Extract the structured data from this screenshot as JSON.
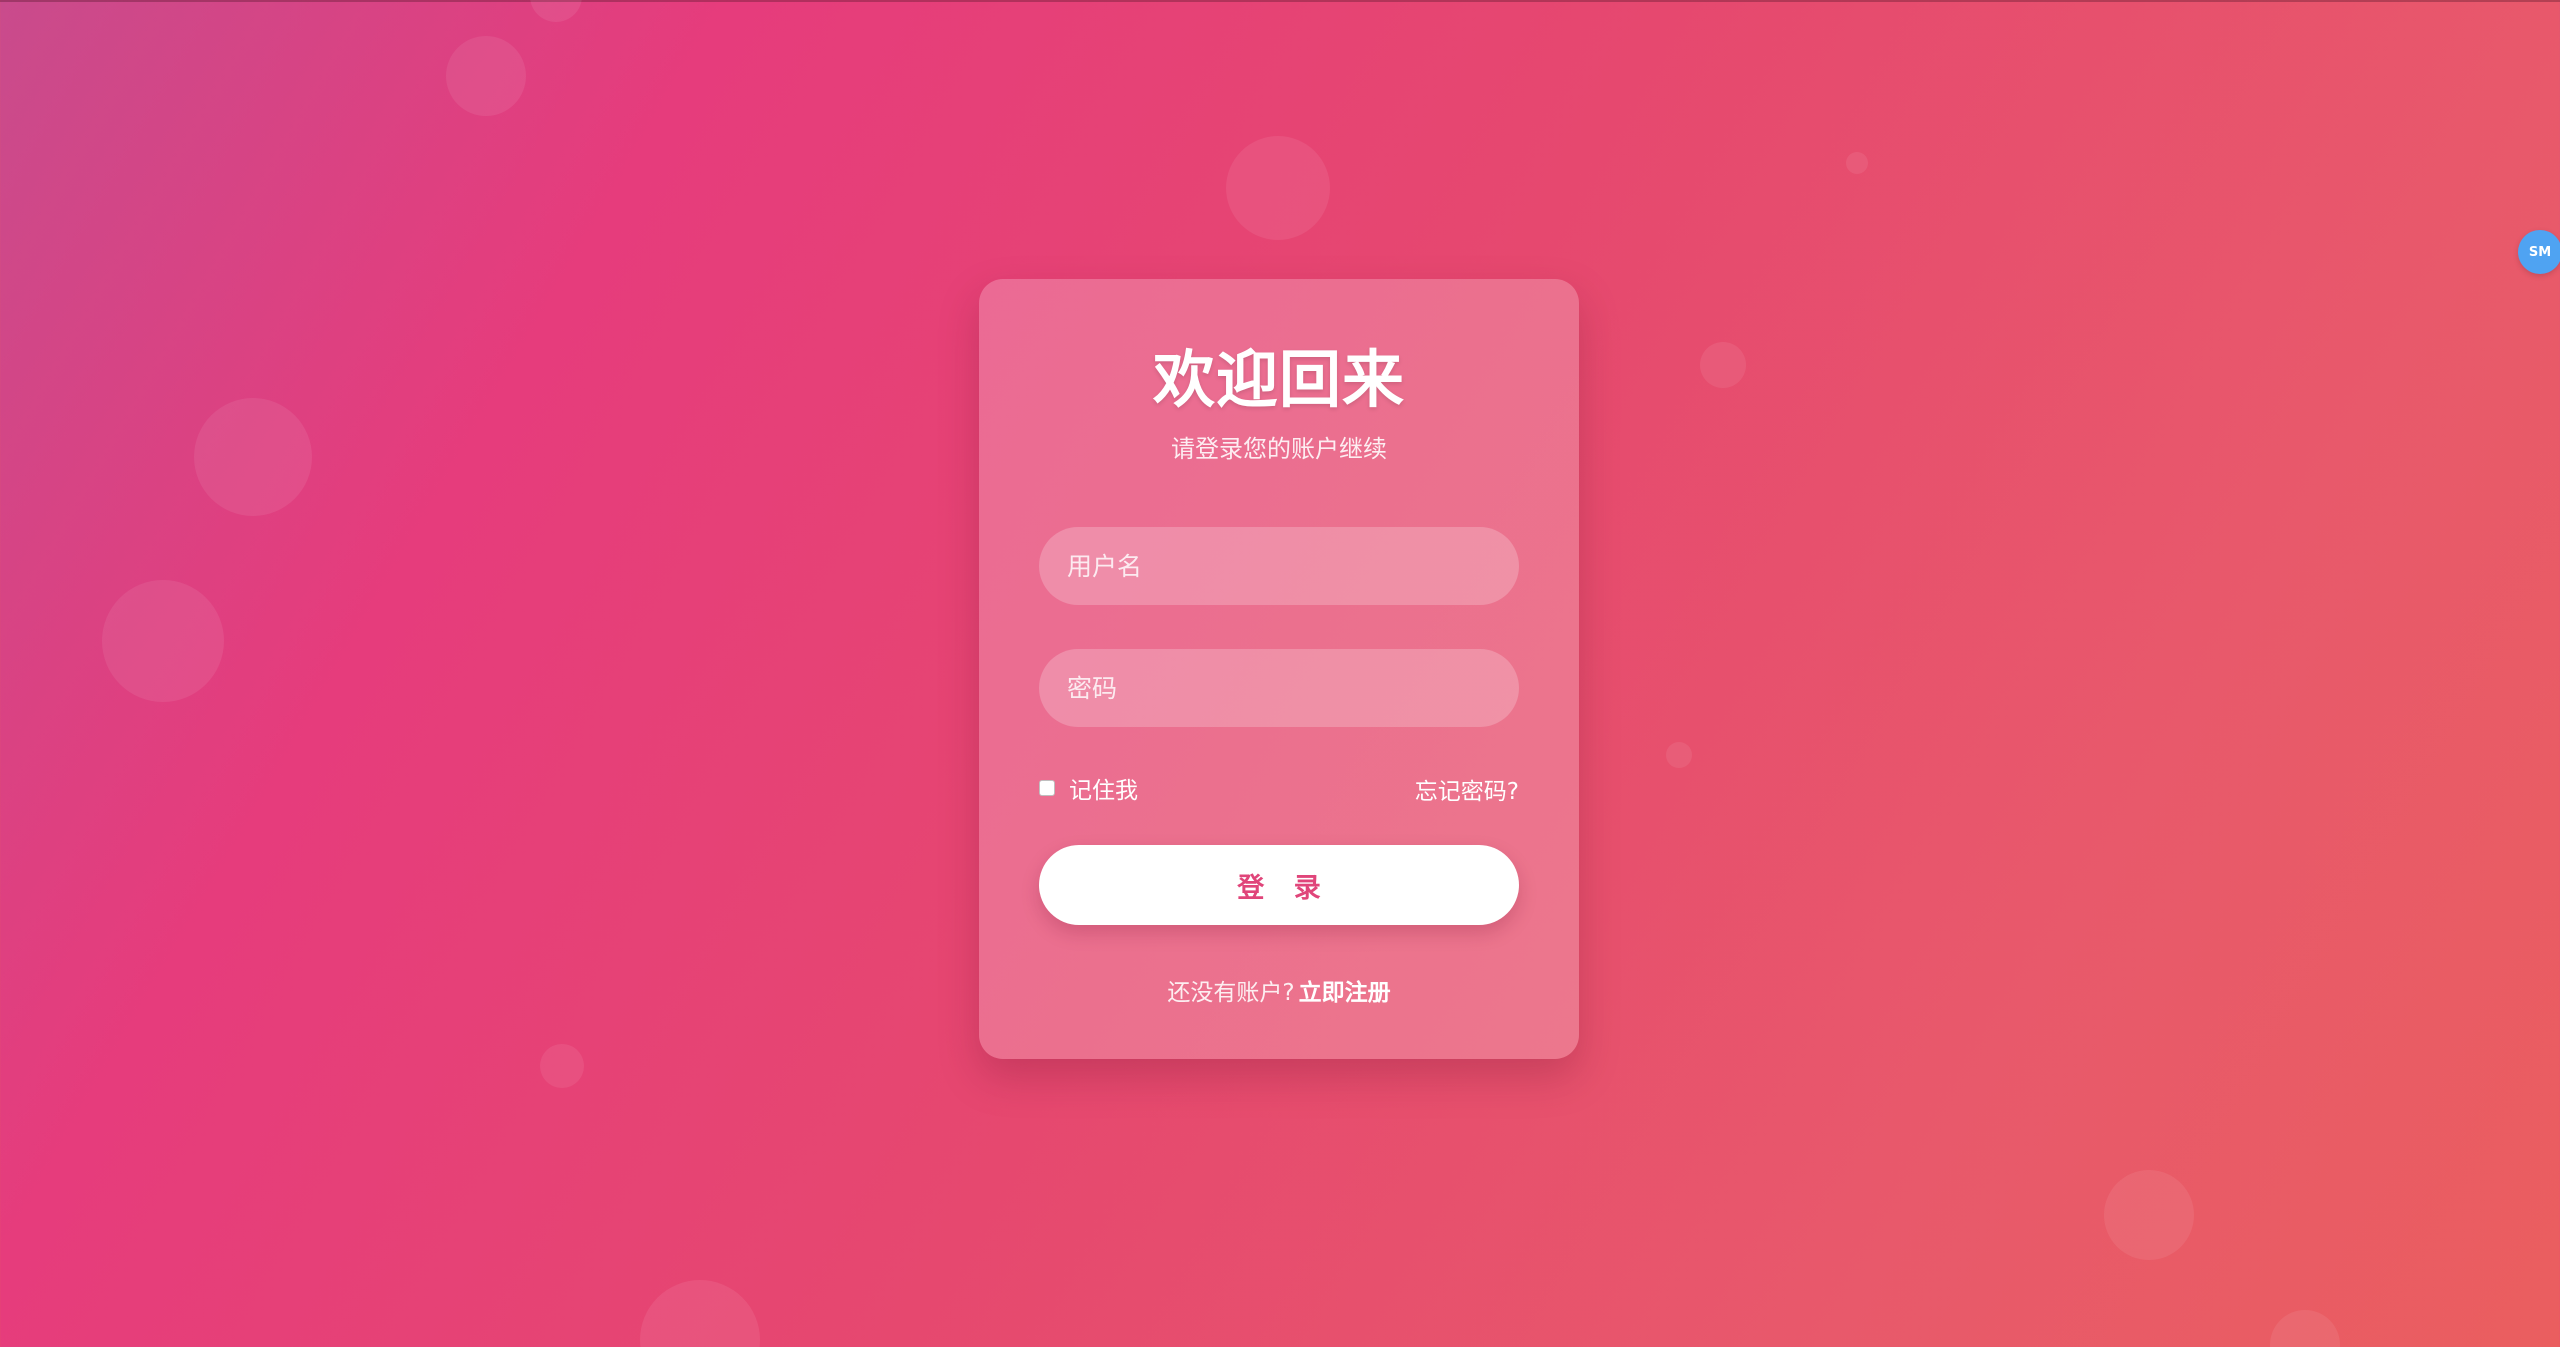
{
  "badge": {
    "text": "SM",
    "color": "#4fa3f2"
  },
  "login": {
    "title": "欢迎回来",
    "subtitle": "请登录您的账户继续",
    "username_placeholder": "用户名",
    "username_value": "",
    "password_placeholder": "密码",
    "password_value": "",
    "remember_label": "记住我",
    "remember_checked": false,
    "forgot_label": "忘记密码?",
    "submit_label": "登 录",
    "signup_prompt": "还没有账户?",
    "signup_link": "立即注册"
  },
  "colors": {
    "background_start": "#c94b8c",
    "background_mid": "#e63c7c",
    "background_end": "#ea5e5f",
    "button_text": "#e0457a",
    "button_bg": "#ffffff"
  }
}
